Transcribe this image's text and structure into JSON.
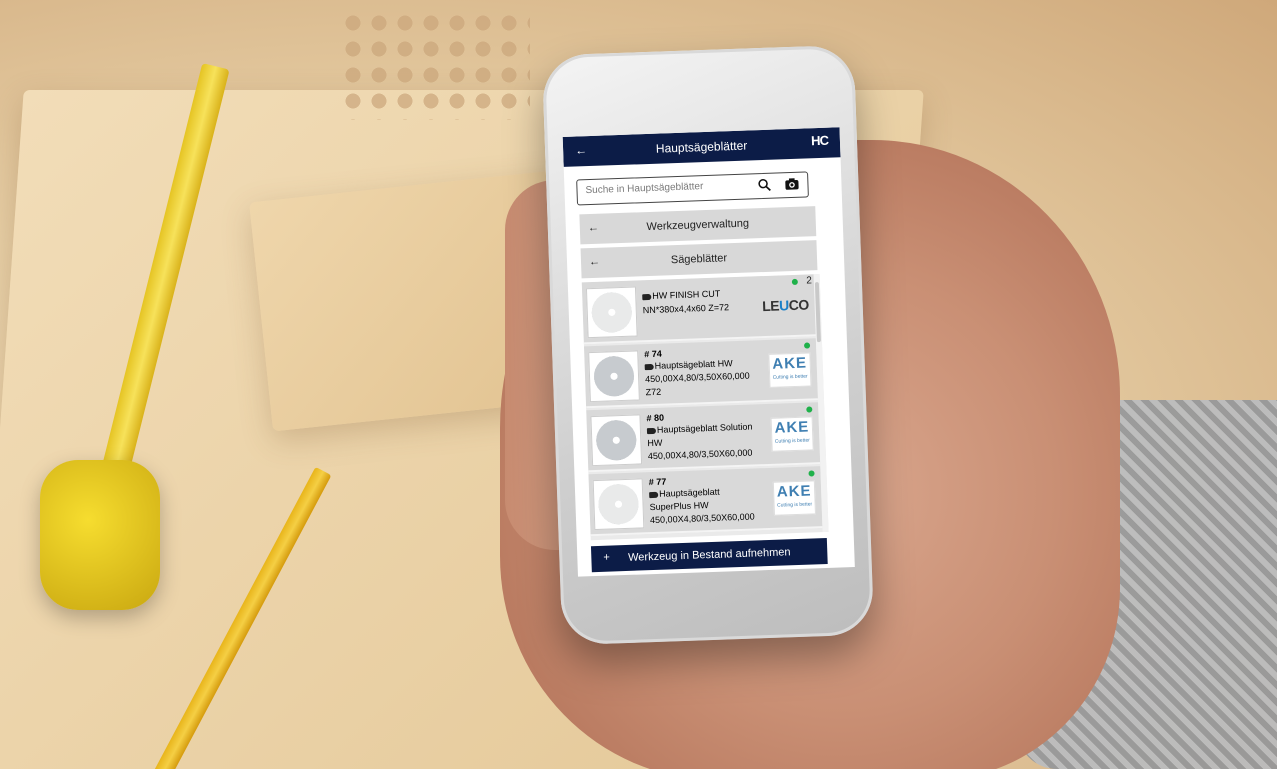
{
  "app": {
    "title": "Hauptsägeblätter",
    "logo": "HC",
    "back_icon": "←"
  },
  "search": {
    "placeholder": "Suche in Hauptsägeblätter"
  },
  "nav": [
    {
      "label": "Werkzeugverwaltung",
      "arrow": "←"
    },
    {
      "label": "Sägeblätter",
      "arrow": "←"
    }
  ],
  "items": [
    {
      "number": "",
      "name": "HW FINISH CUT",
      "detail": "NN*380x4,4x60 Z=72",
      "extra": "",
      "brand": "LEUCO",
      "count": "2"
    },
    {
      "number": "# 74",
      "name": "Hauptsägeblatt HW",
      "detail": "450,00X4,80/3,50X60,000",
      "extra": "Z72",
      "brand": "AKE",
      "count": ""
    },
    {
      "number": "# 80",
      "name": "Hauptsägeblatt Solution",
      "detail": "HW",
      "extra": "450,00X4,80/3,50X60,000",
      "brand": "AKE",
      "count": ""
    },
    {
      "number": "# 77",
      "name": "Hauptsägeblatt",
      "detail": "SuperPlus HW",
      "extra": "450,00X4,80/3,50X60,000",
      "brand": "AKE",
      "count": ""
    }
  ],
  "brand_tagline": "Cutting is better",
  "bottom_button": {
    "icon": "+",
    "label": "Werkzeug in Bestand aufnehmen"
  },
  "colors": {
    "primary": "#0c1c47",
    "status_ok": "#1fb14a",
    "list_bg": "#d9d9d9"
  }
}
